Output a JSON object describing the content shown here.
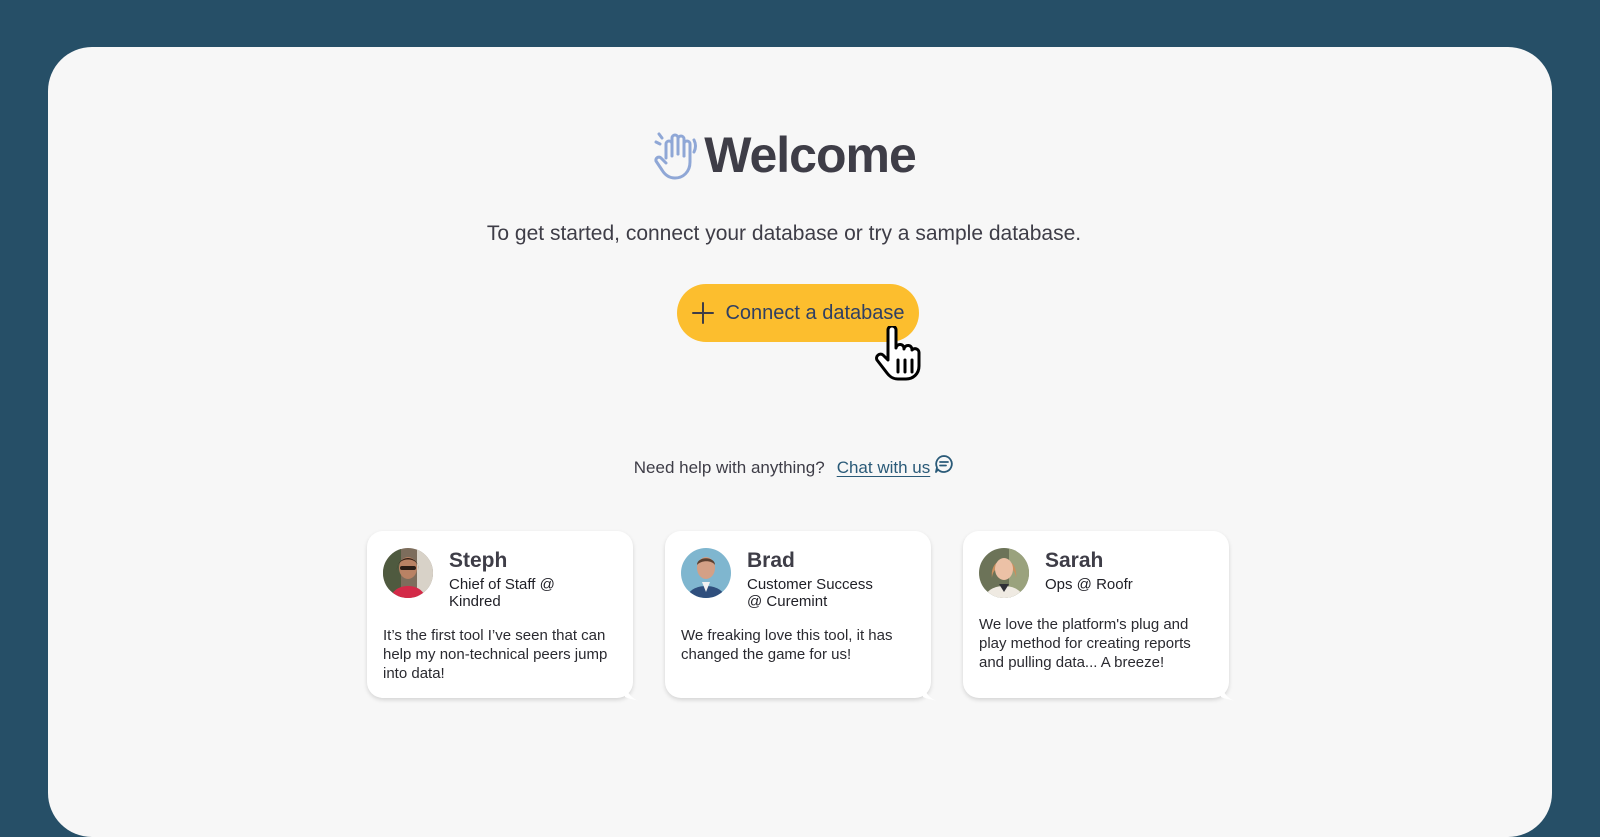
{
  "header": {
    "title": "Welcome",
    "icon": "waving-hand-icon"
  },
  "subtitle": "To get started, connect your database or try a sample database.",
  "connect_button": {
    "label": "Connect a database",
    "icon": "plus-icon"
  },
  "help": {
    "prompt": "Need help with anything?",
    "link_label": "Chat with us",
    "icon": "chat-bubble-icon"
  },
  "testimonials": [
    {
      "name": "Steph",
      "role": "Chief of Staff @ Kindred",
      "quote": "It’s the first tool I’ve seen that can help my non-technical peers jump into data!"
    },
    {
      "name": "Brad",
      "role": "Customer Success @ Curemint",
      "quote": "We freaking love this tool, it has changed the game for us!"
    },
    {
      "name": "Sarah",
      "role": "Ops @ Roofr",
      "quote": "We love the platform's plug and play method for creating reports and pulling data... A breeze!"
    }
  ],
  "colors": {
    "background": "#264f67",
    "panel": "#f7f7f7",
    "accent": "#fcbe2e",
    "text": "#3e3d47",
    "link": "#2a5a78"
  }
}
